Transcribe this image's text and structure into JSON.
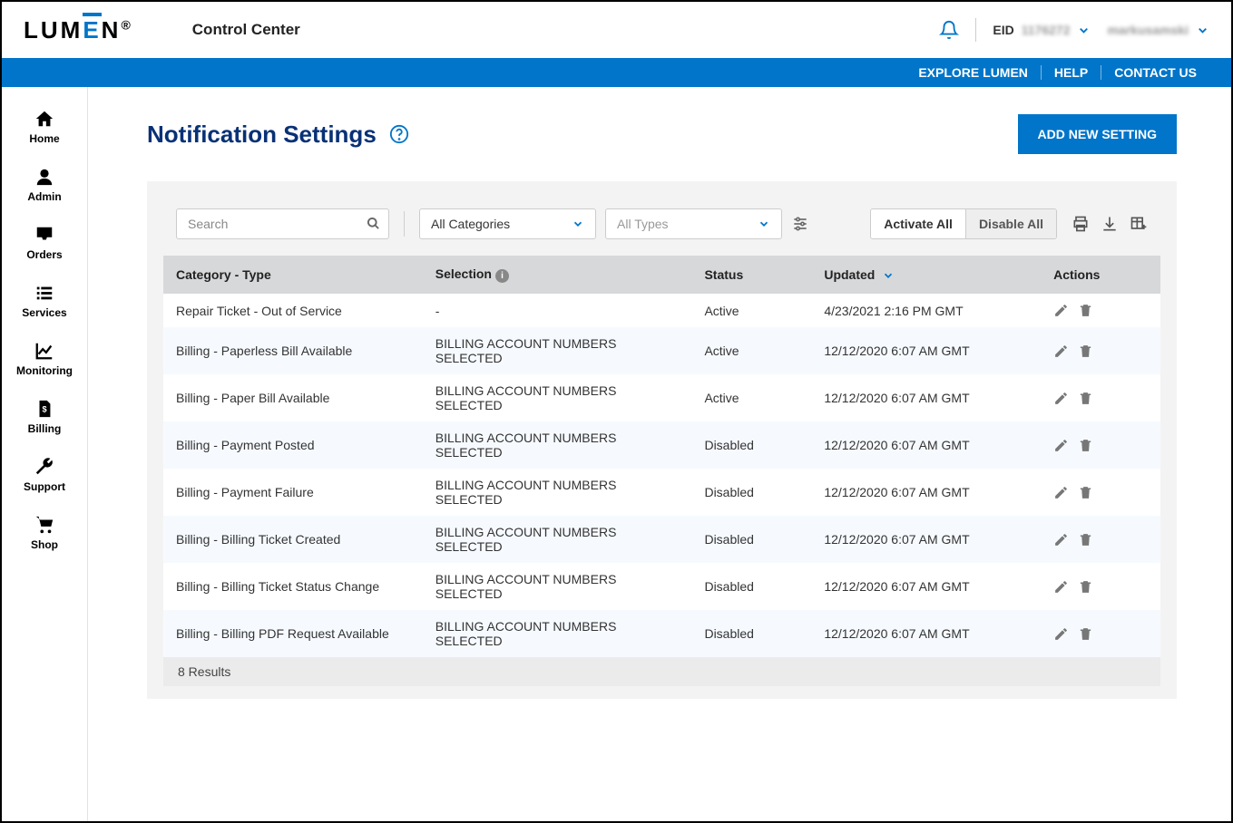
{
  "header": {
    "logo_text": "LUMEN",
    "app_title": "Control Center",
    "eid_label": "EID",
    "eid_value": "1176272",
    "user_name": "markusamski"
  },
  "bluebar": {
    "explore": "EXPLORE LUMEN",
    "help": "HELP",
    "contact": "CONTACT US"
  },
  "sidebar": {
    "items": [
      {
        "label": "Home"
      },
      {
        "label": "Admin"
      },
      {
        "label": "Orders"
      },
      {
        "label": "Services"
      },
      {
        "label": "Monitoring"
      },
      {
        "label": "Billing"
      },
      {
        "label": "Support"
      },
      {
        "label": "Shop"
      }
    ]
  },
  "page": {
    "title": "Notification Settings",
    "add_button": "ADD NEW SETTING"
  },
  "toolbar": {
    "search_placeholder": "Search",
    "category_select": "All Categories",
    "type_select": "All Types",
    "activate_all": "Activate All",
    "disable_all": "Disable All"
  },
  "table": {
    "headers": {
      "category": "Category - Type",
      "selection": "Selection",
      "status": "Status",
      "updated": "Updated",
      "actions": "Actions"
    },
    "rows": [
      {
        "category": "Repair Ticket - Out of Service",
        "selection": "-",
        "status": "Active",
        "updated": "4/23/2021 2:16 PM GMT"
      },
      {
        "category": "Billing - Paperless Bill Available",
        "selection": "BILLING ACCOUNT NUMBERS SELECTED",
        "status": "Active",
        "updated": "12/12/2020 6:07 AM GMT"
      },
      {
        "category": "Billing - Paper Bill Available",
        "selection": "BILLING ACCOUNT NUMBERS SELECTED",
        "status": "Active",
        "updated": "12/12/2020 6:07 AM GMT"
      },
      {
        "category": "Billing - Payment Posted",
        "selection": "BILLING ACCOUNT NUMBERS SELECTED",
        "status": "Disabled",
        "updated": "12/12/2020 6:07 AM GMT"
      },
      {
        "category": "Billing - Payment Failure",
        "selection": "BILLING ACCOUNT NUMBERS SELECTED",
        "status": "Disabled",
        "updated": "12/12/2020 6:07 AM GMT"
      },
      {
        "category": "Billing - Billing Ticket Created",
        "selection": "BILLING ACCOUNT NUMBERS SELECTED",
        "status": "Disabled",
        "updated": "12/12/2020 6:07 AM GMT"
      },
      {
        "category": "Billing - Billing Ticket Status Change",
        "selection": "BILLING ACCOUNT NUMBERS SELECTED",
        "status": "Disabled",
        "updated": "12/12/2020 6:07 AM GMT"
      },
      {
        "category": "Billing - Billing PDF Request Available",
        "selection": "BILLING ACCOUNT NUMBERS SELECTED",
        "status": "Disabled",
        "updated": "12/12/2020 6:07 AM GMT"
      }
    ],
    "results_text": "8 Results"
  }
}
